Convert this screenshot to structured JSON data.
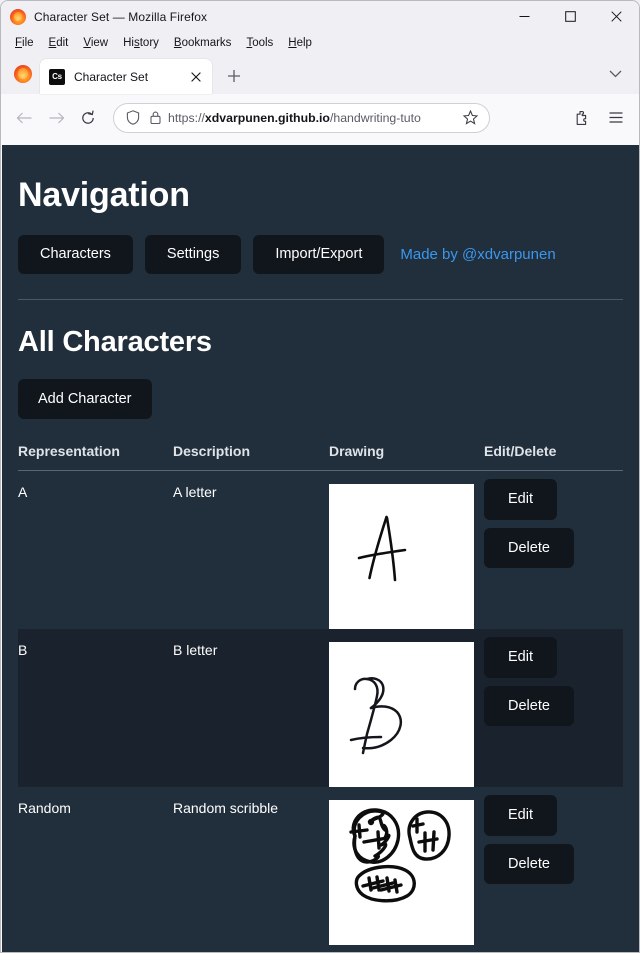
{
  "browser": {
    "window_title": "Character Set — Mozilla Firefox",
    "window_controls": {
      "minimize": "minimize-icon",
      "maximize": "maximize-icon",
      "close": "close-icon"
    },
    "menus": [
      {
        "label": "File",
        "accesskey": "F"
      },
      {
        "label": "Edit",
        "accesskey": "E"
      },
      {
        "label": "View",
        "accesskey": "V"
      },
      {
        "label": "History",
        "accesskey": "s"
      },
      {
        "label": "Bookmarks",
        "accesskey": "B"
      },
      {
        "label": "Tools",
        "accesskey": "T"
      },
      {
        "label": "Help",
        "accesskey": "H"
      }
    ],
    "tab": {
      "title": "Character Set",
      "favicon_text": "Cs"
    },
    "new_tab_label": "+",
    "url": {
      "scheme": "https://",
      "host": "xdvarpunen.github.io",
      "path": "/handwriting-tuto"
    },
    "toolbar_icons": [
      "back-icon",
      "forward-icon",
      "reload-icon",
      "shield-icon",
      "lock-icon",
      "bookmark-star-icon",
      "extensions-icon",
      "app-menu-icon",
      "tab-list-chevron-icon"
    ]
  },
  "page": {
    "nav_heading": "Navigation",
    "nav_buttons": [
      {
        "label": "Characters"
      },
      {
        "label": "Settings"
      },
      {
        "label": "Import/Export"
      }
    ],
    "made_by": "Made by @xdvarpunen",
    "section_heading": "All Characters",
    "add_button": "Add Character",
    "table": {
      "headers": [
        "Representation",
        "Description",
        "Drawing",
        "Edit/Delete"
      ],
      "rows": [
        {
          "representation": "A",
          "description": "A letter",
          "drawing": "handwritten-letter-a",
          "edit": "Edit",
          "delete": "Delete"
        },
        {
          "representation": "B",
          "description": "B letter",
          "drawing": "handwritten-letter-b",
          "edit": "Edit",
          "delete": "Delete"
        },
        {
          "representation": "Random",
          "description": "Random scribble",
          "drawing": "handwritten-scribble",
          "edit": "Edit",
          "delete": "Delete"
        }
      ]
    }
  },
  "colors": {
    "page_background": "#212e3b",
    "row_alt_background": "#1a222d",
    "button_background": "#11161d",
    "link": "#3b97ee",
    "text": "#ffffff",
    "divider": "#5a6573",
    "canvas": "#ffffff",
    "ink": "#0d0d0d"
  }
}
